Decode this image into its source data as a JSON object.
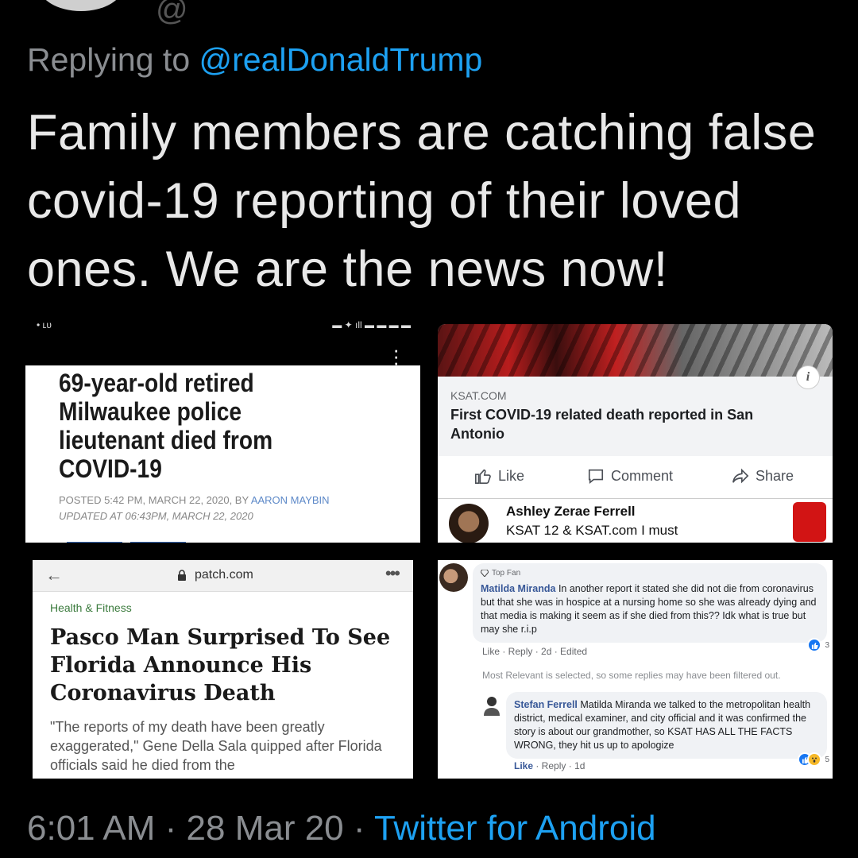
{
  "tweet": {
    "reply_prefix": "Replying to ",
    "reply_mention": "@realDonaldTrump",
    "text": "Family members are catching false covid-19 reporting of their loved ones. We are the news now!",
    "time": "6:01 AM",
    "separator": " · ",
    "date": "28 Mar 20",
    "source": "Twitter for Android"
  },
  "panel_milwaukee": {
    "headline": "69-year-old retired Milwaukee police lieutenant died from COVID-19",
    "byline_prefix": "POSTED 5:42 PM, MARCH 22, 2020, BY ",
    "byline_author": "AARON MAYBIN",
    "byline_updated": "UPDATED AT 06:43PM, MARCH 22, 2020"
  },
  "panel_ksat": {
    "domain": "KSAT.COM",
    "title": "First COVID-19 related death reported in San Antonio",
    "like_label": "Like",
    "comment_label": "Comment",
    "share_label": "Share",
    "commenter_name": "Ashley Zerae Ferrell",
    "comment_preview": "KSAT 12 & KSAT.com I must"
  },
  "panel_patch": {
    "url": "patch.com",
    "category": "Health & Fitness",
    "headline": "Pasco Man Surprised To See Florida Announce His Coronavirus Death",
    "excerpt": "\"The reports of my death have been greatly exaggerated,\" Gene Della Sala quipped after Florida officials said he died from the"
  },
  "panel_comments": {
    "top_fan_label": "Top Fan",
    "comment1_name": "Matilda Miranda",
    "comment1_text": " In another report it stated she did not die from coronavirus but that she was in hospice at a nursing home so she was already dying and that media is making it seem as if she died from this?? Idk what is true but may she r.i.p",
    "comment1_reactions": "3",
    "comment1_meta": "Like · Reply · 2d · Edited",
    "filter_notice": "Most Relevant is selected, so some replies may have been filtered out.",
    "comment2_name": "Stefan Ferrell",
    "comment2_text": " Matilda Miranda we talked to the metropolitan health district, medical examiner, and city official and it was confirmed the story is about our grandmother, so KSAT HAS ALL THE FACTS WRONG, they hit us up to apologize",
    "comment2_like": "Like",
    "comment2_meta": " · Reply · 1d",
    "comment2_reactions": "5"
  },
  "colors": {
    "background": "#000000",
    "mention_blue": "#1da1f2",
    "fb_name_blue": "#385898",
    "fb_like_blue": "#1877f2"
  }
}
